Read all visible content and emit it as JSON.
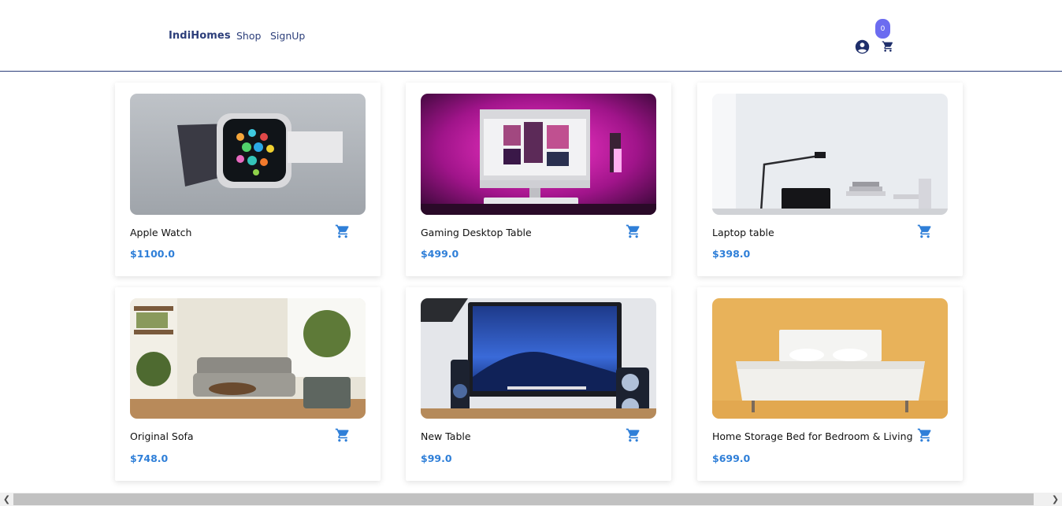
{
  "nav": {
    "brand": "IndiHomes",
    "links": [
      "Shop",
      "SignUp"
    ],
    "cart_count": "0",
    "icons": [
      "account-circle-icon",
      "shopping-cart-icon"
    ]
  },
  "products": [
    {
      "name": "Apple Watch",
      "price": "$1100.0",
      "image": "apple-watch-photo"
    },
    {
      "name": "Gaming Desktop Table",
      "price": "$499.0",
      "image": "gaming-desk-photo"
    },
    {
      "name": "Laptop table",
      "price": "$398.0",
      "image": "laptop-table-photo"
    },
    {
      "name": "Original Sofa",
      "price": "$748.0",
      "image": "sofa-living-room-photo"
    },
    {
      "name": "New Table",
      "price": "$99.0",
      "image": "monitor-table-photo"
    },
    {
      "name": "Home Storage Bed for Bedroom & Living",
      "price": "$699.0",
      "image": "bed-photo"
    }
  ],
  "colors": {
    "brand": "#2c3e7a",
    "price": "#2f7fd8",
    "badge": "#6c6cf0"
  }
}
